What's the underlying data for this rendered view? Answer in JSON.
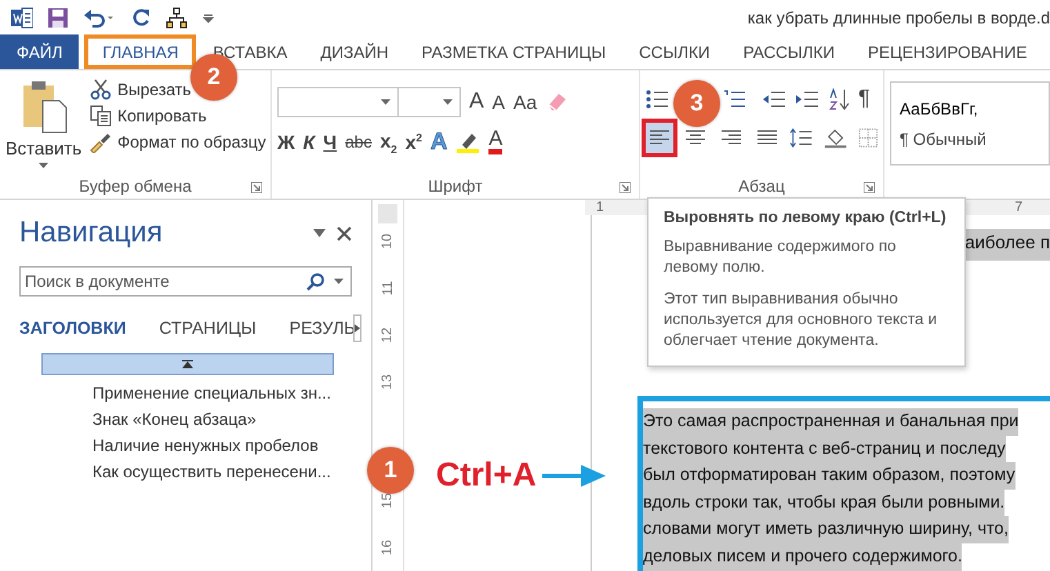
{
  "title_bar": {
    "title": "как убрать длинные пробелы в ворде.d"
  },
  "tabs": [
    {
      "label": "ФАЙЛ",
      "kind": "file",
      "selected": false
    },
    {
      "label": "ГЛАВНАЯ",
      "kind": "tab",
      "selected": true
    },
    {
      "label": "ВСТАВКА",
      "kind": "tab",
      "selected": false
    },
    {
      "label": "ДИЗАЙН",
      "kind": "tab",
      "selected": false
    },
    {
      "label": "РАЗМЕТКА СТРАНИЦЫ",
      "kind": "tab",
      "selected": false
    },
    {
      "label": "ССЫЛКИ",
      "kind": "tab",
      "selected": false
    },
    {
      "label": "РАССЫЛКИ",
      "kind": "tab",
      "selected": false
    },
    {
      "label": "РЕЦЕНЗИРОВАНИЕ",
      "kind": "tab",
      "selected": false
    }
  ],
  "clipboard": {
    "paste": "Вставить",
    "actions": [
      {
        "kind": "cut",
        "label": "Вырезать"
      },
      {
        "kind": "copy",
        "label": "Копировать"
      },
      {
        "kind": "painter",
        "label": "Формат по образцу"
      }
    ],
    "group_label": "Буфер обмена"
  },
  "font": {
    "group_label": "Шрифт",
    "size_buttons": [
      "A",
      "A"
    ],
    "case_button": "Aa",
    "style_buttons": [
      {
        "kind": "bold",
        "label": "Ж"
      },
      {
        "kind": "italic",
        "label": "К"
      },
      {
        "kind": "underline",
        "label": "Ч"
      },
      {
        "kind": "strike",
        "label": "abc"
      }
    ],
    "sub": "x",
    "sub_mark": "2",
    "sup": "x",
    "sup_mark": "2",
    "effects": "A",
    "font_color": "A"
  },
  "paragraph": {
    "group_label": "Абзац",
    "pilcrow": "¶",
    "alignment": [
      {
        "kind": "left",
        "selected": true
      },
      {
        "kind": "center",
        "selected": false
      },
      {
        "kind": "right",
        "selected": false
      },
      {
        "kind": "justify",
        "selected": false
      }
    ]
  },
  "styles": {
    "sample": "АаБбВвГг,",
    "name": "¶ Обычный"
  },
  "navigation": {
    "title": "Навигация",
    "search_placeholder": "Поиск в документе",
    "tabs": [
      {
        "label": "ЗАГОЛОВКИ",
        "selected": true
      },
      {
        "label": "СТРАНИЦЫ",
        "selected": false
      },
      {
        "label": "РЕЗУЛЬ",
        "selected": false
      }
    ],
    "headings": [
      "Применение специальных зн...",
      "Знак «Конец абзаца»",
      "Наличие ненужных пробелов",
      "Как осуществить перенесени..."
    ]
  },
  "ruler": {
    "horizontal": [
      "1",
      "7"
    ],
    "vertical": [
      "10",
      "11",
      "12",
      "13",
      "15",
      "16"
    ]
  },
  "tooltip": {
    "title": "Выровнять по левому краю (Ctrl+L)",
    "paragraphs": [
      "Выравнивание содержимого по левому полю.",
      "Этот тип выравнивания обычно используется для основного текста и облегчает чтение документа."
    ]
  },
  "document": {
    "top_fragment": "аиболее п",
    "shortcut": "Ctrl+A",
    "lines": [
      "Это самая распространенная и банальная при",
      "текстового контента с веб-страниц и последу",
      "был отформатирован таким образом, поэтому",
      "вдоль строки так, чтобы края были ровными.",
      "словами могут иметь различную ширину, что,",
      "деловых писем и прочего содержимого."
    ]
  },
  "callouts": [
    "1",
    "2",
    "3"
  ]
}
